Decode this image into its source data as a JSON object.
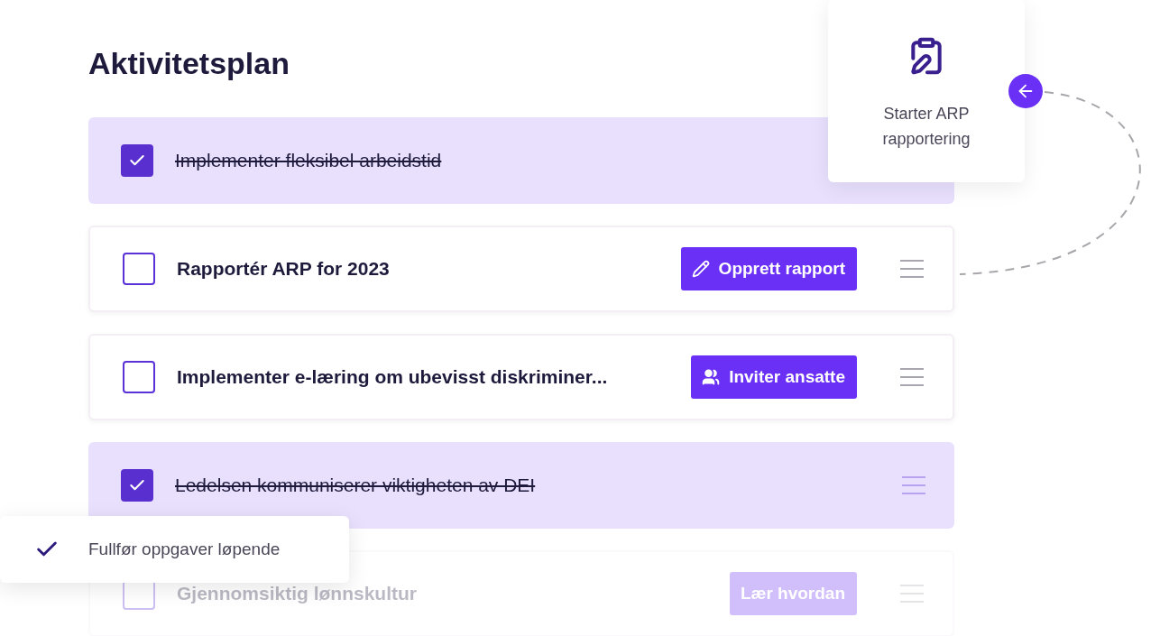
{
  "title": "Aktivitetsplan",
  "tasks": [
    {
      "label": "Implementer fleksibel arbeidstid",
      "checked": true,
      "faded": false,
      "handle": false
    },
    {
      "label": "Rapportér ARP for 2023",
      "checked": false,
      "faded": false,
      "handle": true,
      "button": {
        "label": "Opprett rapport",
        "kind": "edit"
      }
    },
    {
      "label": "Implementer e-læring om ubevisst diskriminer...",
      "checked": false,
      "faded": false,
      "handle": true,
      "button": {
        "label": "Inviter ansatte",
        "kind": "invite"
      }
    },
    {
      "label": "Ledelsen kommuniserer viktigheten av DEI",
      "checked": true,
      "faded": false,
      "handle": true
    },
    {
      "label": "Gjennomsiktig lønnskultur",
      "checked": false,
      "faded": true,
      "handle": true,
      "button": {
        "label": "Lær hvordan",
        "kind": "plain"
      }
    }
  ],
  "step_card": {
    "label": "Starter ARP rapportering"
  },
  "toast": {
    "label": "Fullfør oppgaver løpende"
  }
}
